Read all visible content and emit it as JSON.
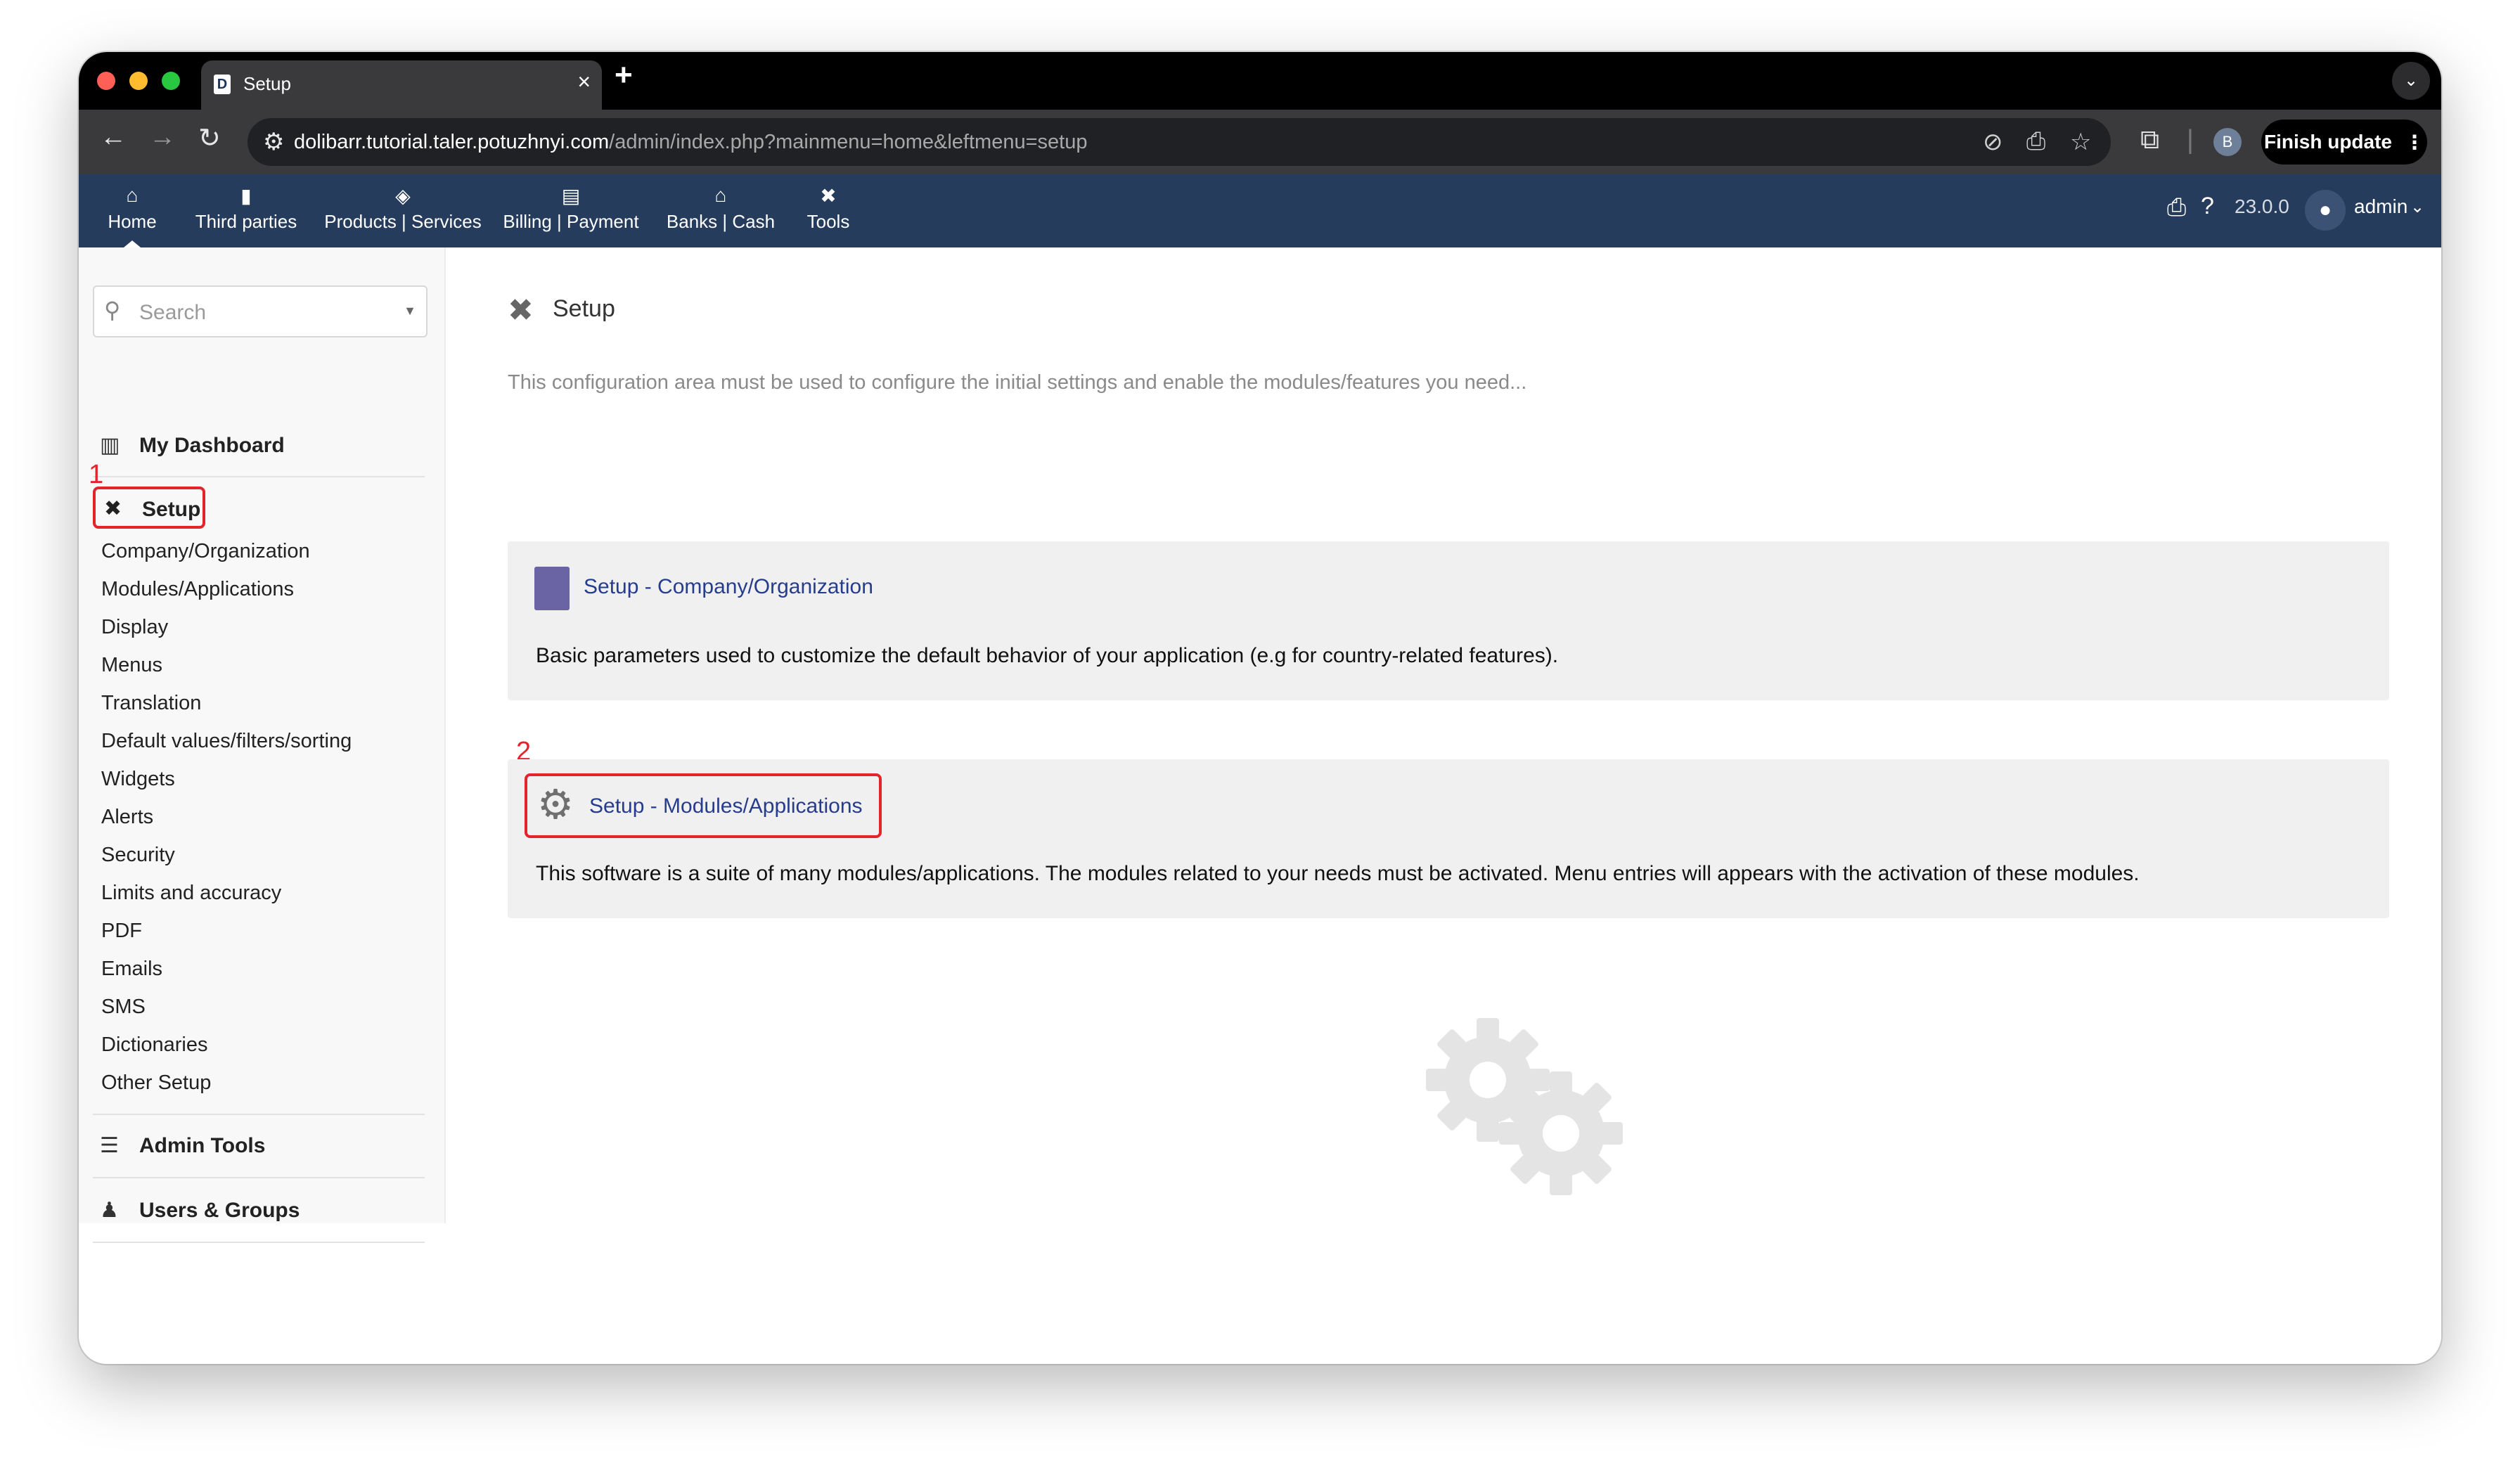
{
  "browser": {
    "tab_title": "Setup",
    "favicon_letter": "D",
    "close_glyph": "×",
    "new_tab_glyph": "+",
    "url_domain": "dolibarr.tutorial.taler.potuzhnyi.com",
    "url_path": "/admin/index.php?mainmenu=home&leftmenu=setup",
    "profile_initial": "B",
    "finish_update_label": "Finish update"
  },
  "topmenu": {
    "items": [
      {
        "label": "Home",
        "icon": "home-icon",
        "active": true
      },
      {
        "label": "Third parties",
        "icon": "building-icon"
      },
      {
        "label": "Products | Services",
        "icon": "cube-icon"
      },
      {
        "label": "Billing | Payment",
        "icon": "invoice-icon"
      },
      {
        "label": "Banks | Cash",
        "icon": "bank-icon"
      },
      {
        "label": "Tools",
        "icon": "tools-icon"
      }
    ],
    "version": "23.0.0",
    "user": "admin"
  },
  "sidebar": {
    "search_placeholder": "Search",
    "dashboard_label": "My Dashboard",
    "setup_label": "Setup",
    "setup_items": [
      "Company/Organization",
      "Modules/Applications",
      "Display",
      "Menus",
      "Translation",
      "Default values/filters/sorting",
      "Widgets",
      "Alerts",
      "Security",
      "Limits and accuracy",
      "PDF",
      "Emails",
      "SMS",
      "Dictionaries",
      "Other Setup"
    ],
    "admin_tools_label": "Admin Tools",
    "users_groups_label": "Users & Groups"
  },
  "main": {
    "title": "Setup",
    "description": "This configuration area must be used to configure the initial settings and enable the modules/features you need...",
    "cards": [
      {
        "link": "Setup - Company/Organization",
        "text": "Basic parameters used to customize the default behavior of your application (e.g for country-related features)."
      },
      {
        "link": "Setup - Modules/Applications",
        "text": "This software is a suite of many modules/applications. The modules related to your needs must be activated. Menu entries will appears with the activation of these modules."
      }
    ]
  },
  "annotations": {
    "step1": "1",
    "step2": "2",
    "color": "#e3242b"
  },
  "colors": {
    "topbar": "#263c5c",
    "link": "#263c8c",
    "card_bg": "#f0f0f0"
  }
}
